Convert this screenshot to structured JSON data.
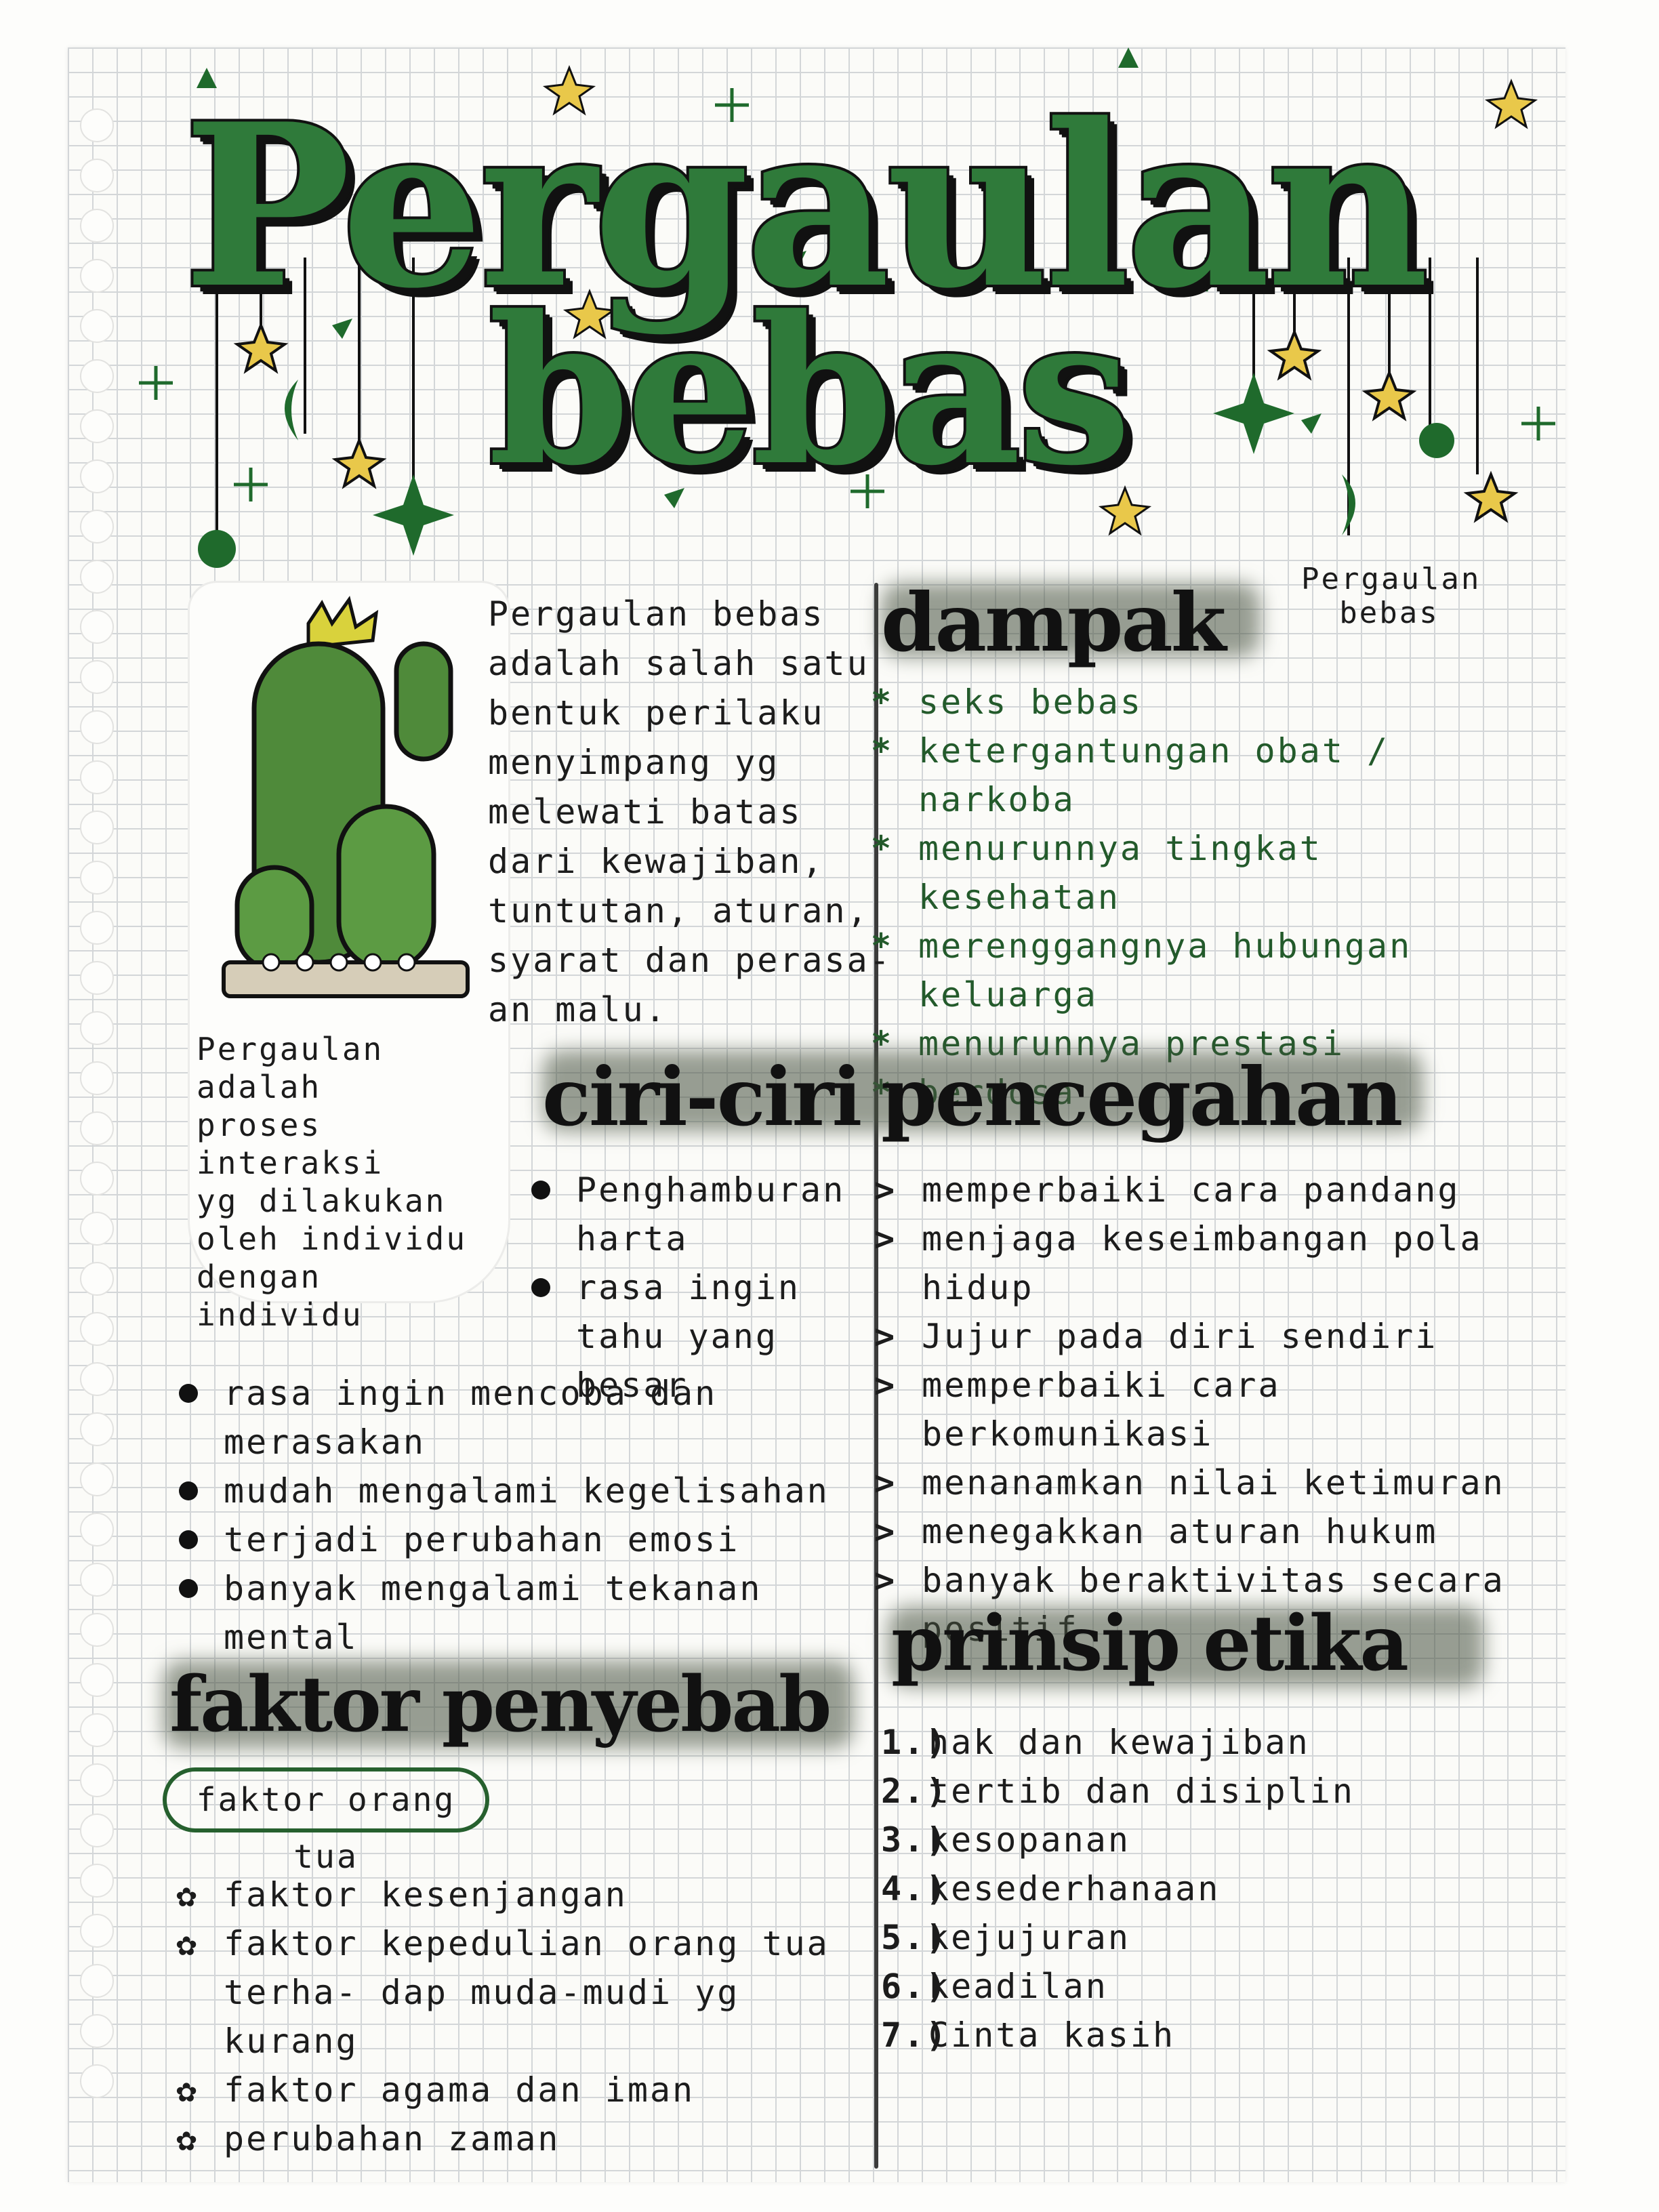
{
  "title": {
    "line1": "Pergaulan",
    "line2": "bebas"
  },
  "intro": {
    "lines": [
      "Pergaulan bebas",
      "adalah salah satu",
      "bentuk perilaku",
      "menyimpang yg",
      "melewati batas",
      "dari kewajiban,",
      "tuntutan, aturan,",
      "syarat dan perasa-",
      "an malu."
    ]
  },
  "cactus_caption": {
    "lines": [
      "Pergaulan adalah",
      "proses interaksi",
      "yg dilakukan",
      "oleh individu",
      "dengan",
      "individu"
    ]
  },
  "dampak": {
    "heading": "dampak",
    "subheading": "Pergaulan bebas",
    "marker": "*",
    "items": [
      "seks bebas",
      "ketergantungan obat / narkoba",
      "menurunnya tingkat kesehatan",
      "merenggangnya hubungan keluarga",
      "menurunnya prestasi",
      "berdosa"
    ]
  },
  "ciri": {
    "heading": "ciri-ciri",
    "items_top": [
      "Penghamburan harta",
      "rasa ingin tahu yang besar"
    ],
    "items": [
      "rasa ingin mencoba dan merasakan",
      "mudah mengalami kegelisahan",
      "terjadi perubahan emosi",
      "banyak mengalami tekanan mental"
    ]
  },
  "pencegahan": {
    "heading": "pencegahan",
    "marker": ">",
    "items": [
      "memperbaiki cara pandang",
      "menjaga keseimbangan pola hidup",
      "Jujur pada diri sendiri",
      "memperbaiki cara berkomunikasi",
      "menanamkan nilai ketimuran",
      "menegakkan aturan hukum",
      "banyak beraktivitas secara positif"
    ]
  },
  "faktor": {
    "heading": "faktor penyebab",
    "pill": "faktor orang tua",
    "marker": "✿",
    "items": [
      "faktor kesenjangan",
      "faktor kepedulian orang tua terha- dap muda-mudi yg kurang",
      "faktor agama dan iman",
      "perubahan zaman"
    ]
  },
  "prinsip": {
    "heading": "prinsip etika",
    "items": [
      {
        "num": "1.)",
        "text": "hak dan kewajiban"
      },
      {
        "num": "2.)",
        "text": "tertib dan disiplin"
      },
      {
        "num": "3.)",
        "text": "kesopanan"
      },
      {
        "num": "4.)",
        "text": "kesederhanaan"
      },
      {
        "num": "5.)",
        "text": "kejujuran"
      },
      {
        "num": "6.)",
        "text": "keadilan"
      },
      {
        "num": "7.)",
        "text": "Cinta kasih"
      }
    ]
  },
  "colors": {
    "ink": "#1c1c1c",
    "green_ink": "#235a2b",
    "title_green": "#2f7a3a",
    "cactus_green": "#4f8a3a",
    "flower_yellow": "#d9d23c",
    "star_yellow": "#e9c84a",
    "grid": "#d3d6d8"
  },
  "icons": {
    "title_decor": "hanging-stars-moons-planets-icons",
    "cactus": "cactus-pot-illustration"
  }
}
